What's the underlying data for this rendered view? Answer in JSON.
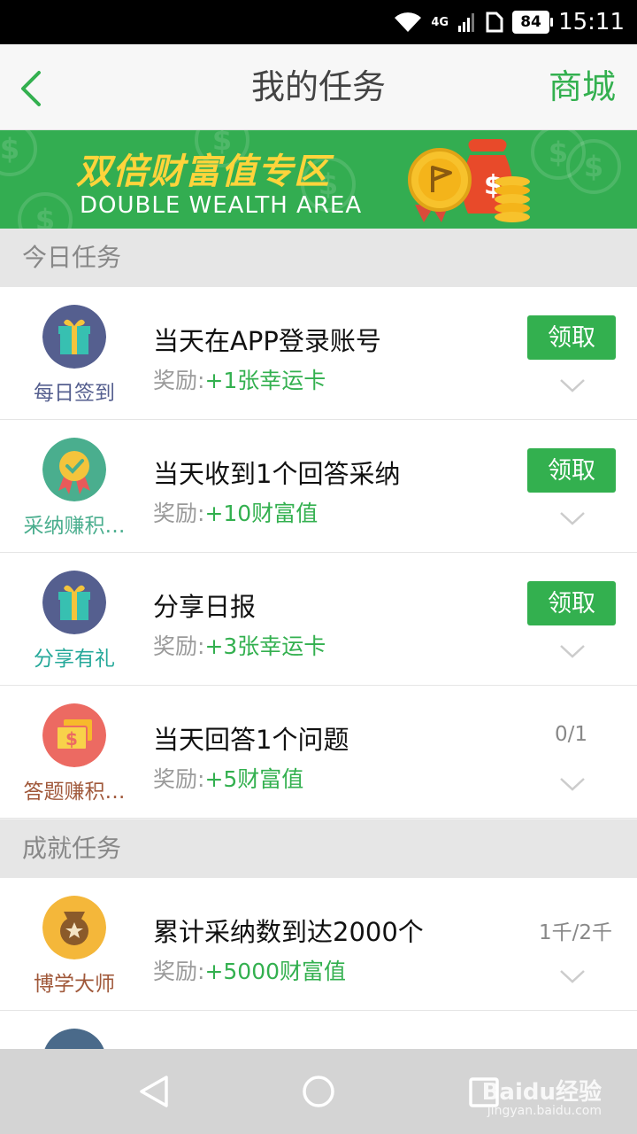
{
  "status_bar": {
    "time": "15:11",
    "battery": "84",
    "network": "4G"
  },
  "header": {
    "title": "我的任务",
    "right_action": "商城"
  },
  "banner": {
    "title": "双倍财富值专区",
    "subtitle": "DOUBLE WEALTH AREA"
  },
  "today": {
    "label": "今日任务",
    "tasks": [
      {
        "tag": "每日签到",
        "name": "当天在APP登录账号",
        "reward_label": "奖励:",
        "reward": "+1张幸运卡",
        "action": "领取"
      },
      {
        "tag": "采纳赚积…",
        "name": "当天收到1个回答采纳",
        "reward_label": "奖励:",
        "reward": "+10财富值",
        "action": "领取"
      },
      {
        "tag": "分享有礼",
        "name": "分享日报",
        "reward_label": "奖励:",
        "reward": "+3张幸运卡",
        "action": "领取"
      },
      {
        "tag": "答题赚积…",
        "name": "当天回答1个问题",
        "reward_label": "奖励:",
        "reward": "+5财富值",
        "progress": "0/1"
      }
    ]
  },
  "achievements": {
    "label": "成就任务",
    "tasks": [
      {
        "tag": "博学大师",
        "name": "累计采纳数到达2000个",
        "reward_label": "奖励:",
        "reward": "+5000财富值",
        "progress": "1千/2千"
      }
    ]
  },
  "watermark": {
    "brand": "Baidu经验",
    "url": "jingyan.baidu.com"
  },
  "colors": {
    "accent": "#33b04f",
    "banner": "#33ad51",
    "banner_text": "#ffd43b"
  },
  "icons": [
    "back-chevron-icon",
    "gift-icon",
    "badge-check-icon",
    "money-bill-icon",
    "medal-icon",
    "chevron-down-icon",
    "nav-back-icon",
    "nav-home-icon",
    "nav-recents-icon",
    "wifi-icon",
    "signal-icon",
    "sim-icon"
  ]
}
